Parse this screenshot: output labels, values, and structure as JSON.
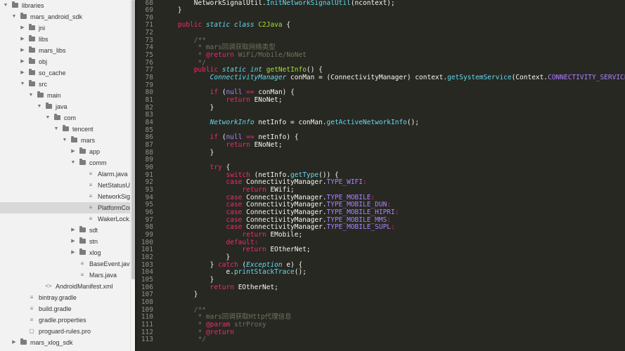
{
  "project_tree": [
    {
      "label": "libraries",
      "kind": "folder",
      "expanded": true,
      "depth": 0
    },
    {
      "label": "mars_android_sdk",
      "kind": "folder",
      "expanded": true,
      "depth": 1
    },
    {
      "label": "jni",
      "kind": "folder",
      "expanded": false,
      "depth": 2
    },
    {
      "label": "libs",
      "kind": "folder",
      "expanded": false,
      "depth": 2
    },
    {
      "label": "mars_libs",
      "kind": "folder",
      "expanded": false,
      "depth": 2
    },
    {
      "label": "obj",
      "kind": "folder",
      "expanded": false,
      "depth": 2
    },
    {
      "label": "so_cache",
      "kind": "folder",
      "expanded": false,
      "depth": 2
    },
    {
      "label": "src",
      "kind": "folder",
      "expanded": true,
      "depth": 2
    },
    {
      "label": "main",
      "kind": "folder",
      "expanded": true,
      "depth": 3
    },
    {
      "label": "java",
      "kind": "folder",
      "expanded": true,
      "depth": 4
    },
    {
      "label": "com",
      "kind": "folder",
      "expanded": true,
      "depth": 5
    },
    {
      "label": "tencent",
      "kind": "folder",
      "expanded": true,
      "depth": 6
    },
    {
      "label": "mars",
      "kind": "folder",
      "expanded": true,
      "depth": 7
    },
    {
      "label": "app",
      "kind": "folder",
      "expanded": false,
      "depth": 8
    },
    {
      "label": "comm",
      "kind": "folder",
      "expanded": true,
      "depth": 8
    },
    {
      "label": "Alarm.java",
      "kind": "file",
      "depth": 9
    },
    {
      "label": "NetStatusUtil.java",
      "kind": "file",
      "depth": 9
    },
    {
      "label": "NetworkSignalUtil.java",
      "kind": "file",
      "depth": 9
    },
    {
      "label": "PlatformComm.java",
      "kind": "file",
      "depth": 9,
      "selected": true
    },
    {
      "label": "WakerLock.java",
      "kind": "file",
      "depth": 9
    },
    {
      "label": "sdt",
      "kind": "folder",
      "expanded": false,
      "depth": 8
    },
    {
      "label": "stn",
      "kind": "folder",
      "expanded": false,
      "depth": 8
    },
    {
      "label": "xlog",
      "kind": "folder",
      "expanded": false,
      "depth": 8
    },
    {
      "label": "BaseEvent.java",
      "kind": "file",
      "depth": 8
    },
    {
      "label": "Mars.java",
      "kind": "file",
      "depth": 8
    },
    {
      "label": "AndroidManifest.xml",
      "kind": "xml",
      "depth": 4
    },
    {
      "label": "bintray.gradle",
      "kind": "file",
      "depth": 2
    },
    {
      "label": "build.gradle",
      "kind": "file",
      "depth": 2
    },
    {
      "label": "gradle.properties",
      "kind": "file",
      "depth": 2
    },
    {
      "label": "proguard-rules.pro",
      "kind": "doc",
      "depth": 2
    },
    {
      "label": "mars_xlog_sdk",
      "kind": "folder",
      "expanded": false,
      "depth": 1
    }
  ],
  "editor": {
    "first_line": 68,
    "lines": [
      [
        [
          "",
          "        NetworkSignalUtil."
        ],
        [
          "fn",
          "InitNetworkSignalUtil"
        ],
        [
          "",
          "(ncontext);"
        ]
      ],
      [
        [
          "",
          "    }"
        ]
      ],
      [],
      [
        [
          "",
          "    "
        ],
        [
          "kw",
          "public"
        ],
        [
          "",
          ""
        ],
        [
          "st",
          " static "
        ],
        [
          "ty",
          "class"
        ],
        [
          "",
          " "
        ],
        [
          "cls",
          "C2Java"
        ],
        [
          "",
          " {"
        ]
      ],
      [],
      [
        [
          "",
          "        "
        ],
        [
          "cm",
          "/**"
        ]
      ],
      [
        [
          "",
          "        "
        ],
        [
          "cm",
          " * mars回调获取网络类型"
        ]
      ],
      [
        [
          "",
          "        "
        ],
        [
          "cm",
          " * "
        ],
        [
          "kw",
          "@return"
        ],
        [
          "cm",
          " WiFi/Mobile/NoNet"
        ]
      ],
      [
        [
          "",
          "        "
        ],
        [
          "cm",
          " */"
        ]
      ],
      [
        [
          "",
          "        "
        ],
        [
          "kw",
          "public"
        ],
        [
          "st",
          " static "
        ],
        [
          "ty",
          "int"
        ],
        [
          "",
          " "
        ],
        [
          "cls",
          "getNetInfo"
        ],
        [
          "",
          "() {"
        ]
      ],
      [
        [
          "",
          "            "
        ],
        [
          "ty",
          "ConnectivityManager"
        ],
        [
          "",
          " conMan = (ConnectivityManager) context."
        ],
        [
          "fn",
          "getSystemService"
        ],
        [
          "",
          "(Context."
        ],
        [
          "cn",
          "CONNECTIVITY_SERVICE"
        ],
        [
          "",
          ");"
        ]
      ],
      [],
      [
        [
          "",
          "            "
        ],
        [
          "kw",
          "if"
        ],
        [
          "",
          " ("
        ],
        [
          "cn",
          "null"
        ],
        [
          "",
          " "
        ],
        [
          "kw",
          "=="
        ],
        [
          "",
          " conMan) {"
        ]
      ],
      [
        [
          "",
          "                "
        ],
        [
          "kw",
          "return"
        ],
        [
          "",
          " ENoNet;"
        ]
      ],
      [
        [
          "",
          "            }"
        ]
      ],
      [],
      [
        [
          "",
          "            "
        ],
        [
          "ty",
          "NetworkInfo"
        ],
        [
          "",
          " netInfo = conMan."
        ],
        [
          "fn",
          "getActiveNetworkInfo"
        ],
        [
          "",
          "();"
        ]
      ],
      [],
      [
        [
          "",
          "            "
        ],
        [
          "kw",
          "if"
        ],
        [
          "",
          " ("
        ],
        [
          "cn",
          "null"
        ],
        [
          "",
          " "
        ],
        [
          "kw",
          "=="
        ],
        [
          "",
          " netInfo) {"
        ]
      ],
      [
        [
          "",
          "                "
        ],
        [
          "kw",
          "return"
        ],
        [
          "",
          " ENoNet;"
        ]
      ],
      [
        [
          "",
          "            }"
        ]
      ],
      [],
      [
        [
          "",
          "            "
        ],
        [
          "kw",
          "try"
        ],
        [
          "",
          " {"
        ]
      ],
      [
        [
          "",
          "                "
        ],
        [
          "kw",
          "switch"
        ],
        [
          "",
          " (netInfo."
        ],
        [
          "fn",
          "getType"
        ],
        [
          "",
          "()) {"
        ]
      ],
      [
        [
          "",
          "                "
        ],
        [
          "kw",
          "case"
        ],
        [
          "",
          " ConnectivityManager."
        ],
        [
          "cn",
          "TYPE_WIFI"
        ],
        [
          "kw",
          ":"
        ]
      ],
      [
        [
          "",
          "                    "
        ],
        [
          "kw",
          "return"
        ],
        [
          "",
          " EWifi;"
        ]
      ],
      [
        [
          "",
          "                "
        ],
        [
          "kw",
          "case"
        ],
        [
          "",
          " ConnectivityManager."
        ],
        [
          "cn",
          "TYPE_MOBILE"
        ],
        [
          "kw",
          ":"
        ]
      ],
      [
        [
          "",
          "                "
        ],
        [
          "kw",
          "case"
        ],
        [
          "",
          " ConnectivityManager."
        ],
        [
          "cn",
          "TYPE_MOBILE_DUN"
        ],
        [
          "kw",
          ":"
        ]
      ],
      [
        [
          "",
          "                "
        ],
        [
          "kw",
          "case"
        ],
        [
          "",
          " ConnectivityManager."
        ],
        [
          "cn",
          "TYPE_MOBILE_HIPRI"
        ],
        [
          "kw",
          ":"
        ]
      ],
      [
        [
          "",
          "                "
        ],
        [
          "kw",
          "case"
        ],
        [
          "",
          " ConnectivityManager."
        ],
        [
          "cn",
          "TYPE_MOBILE_MMS"
        ],
        [
          "kw",
          ":"
        ]
      ],
      [
        [
          "",
          "                "
        ],
        [
          "kw",
          "case"
        ],
        [
          "",
          " ConnectivityManager."
        ],
        [
          "cn",
          "TYPE_MOBILE_SUPL"
        ],
        [
          "kw",
          ":"
        ]
      ],
      [
        [
          "",
          "                    "
        ],
        [
          "kw",
          "return"
        ],
        [
          "",
          " EMobile;"
        ]
      ],
      [
        [
          "",
          "                "
        ],
        [
          "kw",
          "default"
        ],
        [
          "kw",
          ":"
        ]
      ],
      [
        [
          "",
          "                    "
        ],
        [
          "kw",
          "return"
        ],
        [
          "",
          " EOtherNet;"
        ]
      ],
      [
        [
          "",
          "                }"
        ]
      ],
      [
        [
          "",
          "            } "
        ],
        [
          "kw",
          "catch"
        ],
        [
          "",
          " ("
        ],
        [
          "ex",
          "Exception"
        ],
        [
          "",
          " e) {"
        ]
      ],
      [
        [
          "",
          "                e."
        ],
        [
          "fn",
          "printStackTrace"
        ],
        [
          "",
          "();"
        ]
      ],
      [
        [
          "",
          "            }"
        ]
      ],
      [
        [
          "",
          "            "
        ],
        [
          "kw",
          "return"
        ],
        [
          "",
          " EOtherNet;"
        ]
      ],
      [
        [
          "",
          "        }"
        ]
      ],
      [],
      [
        [
          "",
          "        "
        ],
        [
          "cm",
          "/**"
        ]
      ],
      [
        [
          "",
          "        "
        ],
        [
          "cm",
          " * mars回调获取Http代理信息"
        ]
      ],
      [
        [
          "",
          "        "
        ],
        [
          "cm",
          " * "
        ],
        [
          "kw",
          "@param"
        ],
        [
          "cm",
          " strProxy"
        ]
      ],
      [
        [
          "",
          "        "
        ],
        [
          "cm",
          " * "
        ],
        [
          "kw",
          "@return"
        ]
      ],
      [
        [
          "",
          "        "
        ],
        [
          "cm",
          " */"
        ]
      ]
    ]
  },
  "colors": {
    "sidebar_bg": "#f2f2f2",
    "editor_bg": "#272822",
    "selected_row": "#d8d8d8"
  }
}
